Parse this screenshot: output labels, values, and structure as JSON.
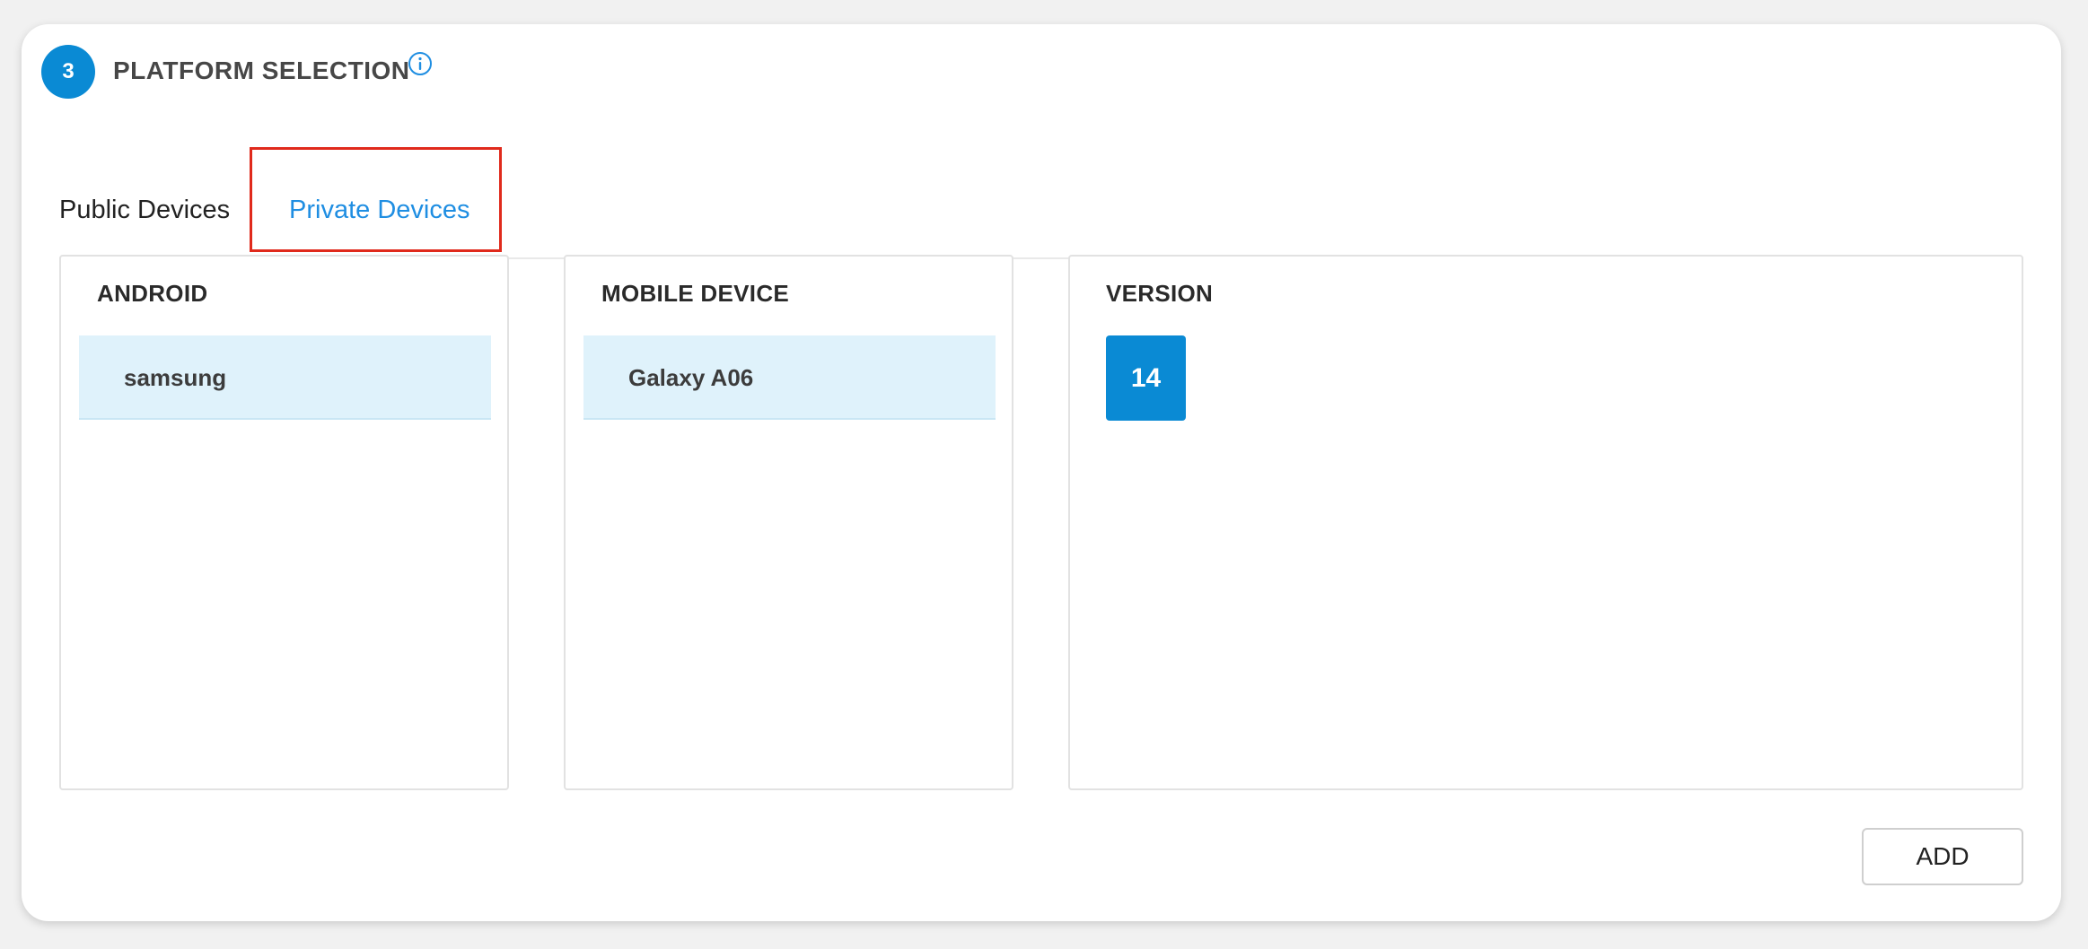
{
  "section": {
    "step_number": "3",
    "title": "PLATFORM SELECTION"
  },
  "tabs": [
    {
      "label": "Public Devices",
      "active": false
    },
    {
      "label": "Private Devices",
      "active": true
    }
  ],
  "panels": {
    "platform": {
      "header": "ANDROID",
      "items": [
        {
          "label": "samsung",
          "selected": true
        }
      ]
    },
    "device": {
      "header": "MOBILE DEVICE",
      "items": [
        {
          "label": "Galaxy A06",
          "selected": true
        }
      ]
    },
    "version": {
      "header": "VERSION",
      "items": [
        {
          "label": "14",
          "selected": true
        }
      ]
    }
  },
  "actions": {
    "add_label": "ADD"
  },
  "icons": {
    "info": "info-icon"
  },
  "colors": {
    "accent": "#0a8ad4",
    "tab_active": "#1f8ee2",
    "selected_row": "#dff2fb",
    "highlight": "#e02a1c"
  }
}
